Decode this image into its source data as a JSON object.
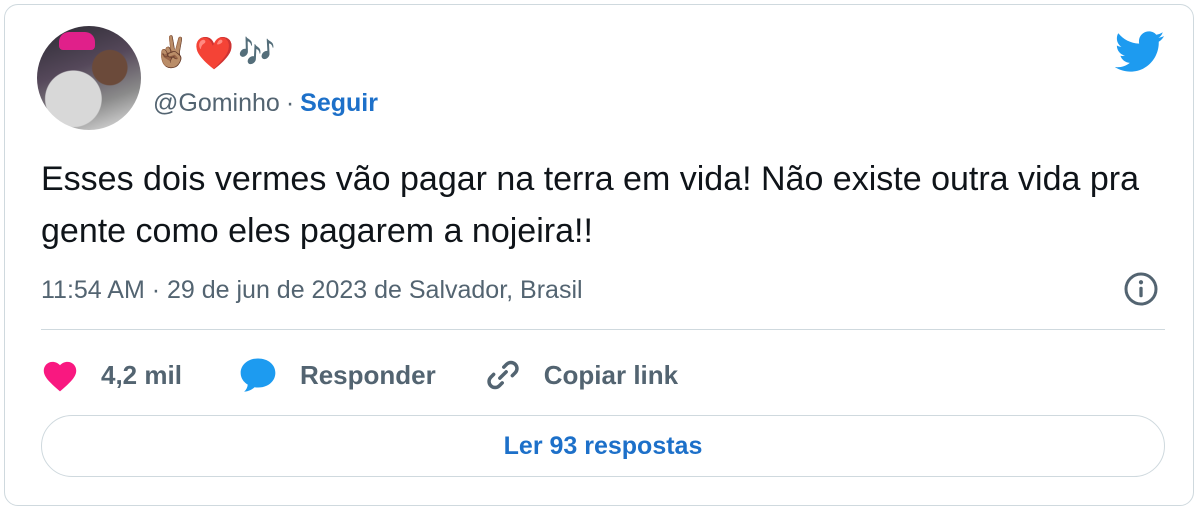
{
  "user": {
    "display_name_emojis": [
      "✌🏽",
      "❤️",
      "🎶"
    ],
    "handle": "@Gominho",
    "separator": "·",
    "follow_label": "Seguir"
  },
  "tweet": {
    "text": "Esses dois vermes vão pagar na terra em vida! Não existe outra vida pra gente como eles pagarem a nojeira!!",
    "timestamp": "11:54 AM · 29 de jun de 2023 de Salvador, Brasil"
  },
  "actions": {
    "like_count": "4,2 mil",
    "reply_label": "Responder",
    "copy_link_label": "Copiar link"
  },
  "read_replies_label": "Ler 93 respostas",
  "icons": {
    "brand": "twitter-bird-icon",
    "info": "info-icon",
    "like": "heart-icon",
    "reply": "speech-bubble-icon",
    "copy": "link-icon"
  },
  "colors": {
    "twitter_blue": "#1d9bf0",
    "link_blue": "#1d70c9",
    "like_pink": "#f91880",
    "reply_blue": "#1d9bf0",
    "muted_gray": "#536471",
    "border": "#cfd9de"
  }
}
